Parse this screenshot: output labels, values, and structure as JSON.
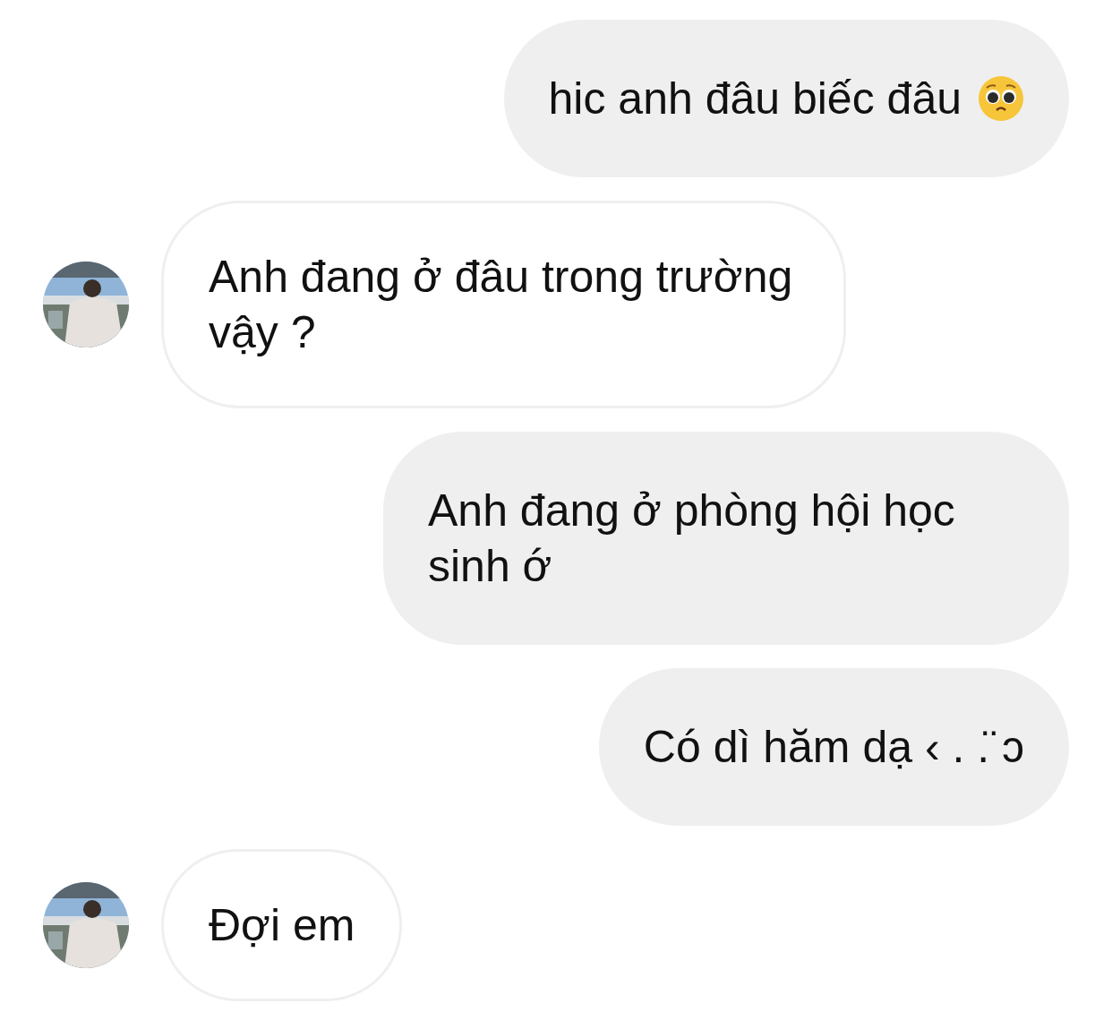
{
  "messages": [
    {
      "kind": "outgoing",
      "text": "hic anh đâu biếc đâu",
      "emoji": true,
      "avatar": false
    },
    {
      "kind": "incoming",
      "text": "Anh đang ở đâu trong trường vậy ?",
      "emoji": false,
      "avatar": true
    },
    {
      "kind": "outgoing",
      "text": "Anh đang ở phòng hội học sinh ớ",
      "emoji": false,
      "avatar": false
    },
    {
      "kind": "outgoing",
      "text": "Có dì hăm dạ ‹ . .̈ ɔ",
      "emoji": false,
      "avatar": false
    },
    {
      "kind": "incoming",
      "text": "Đợi em",
      "emoji": false,
      "avatar": true
    }
  ]
}
